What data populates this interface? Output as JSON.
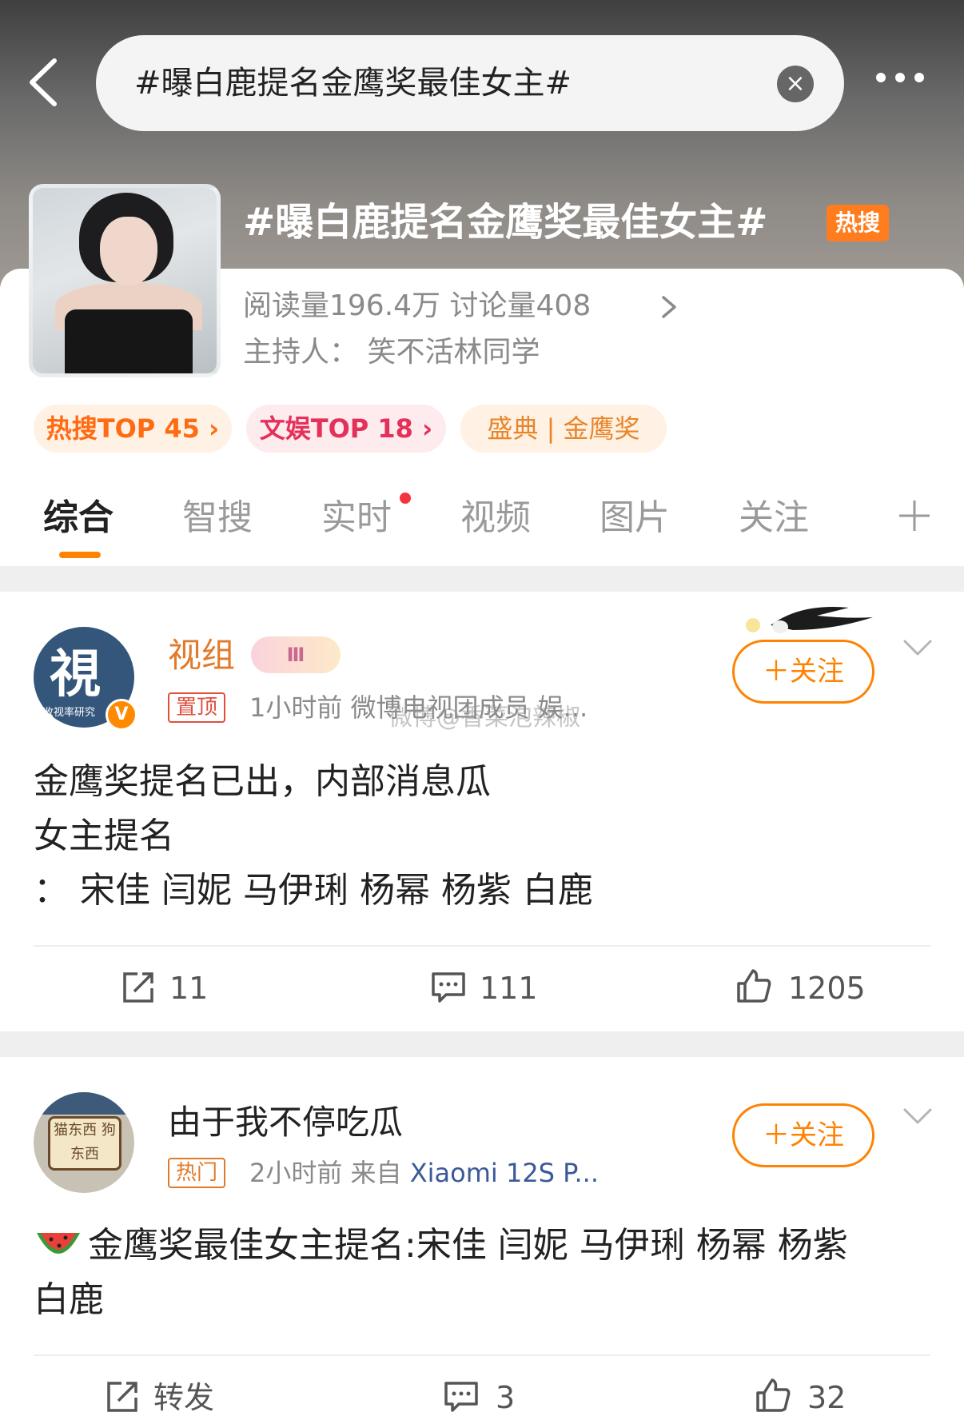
{
  "search": {
    "query": "#曝白鹿提名金鹰奖最佳女主#"
  },
  "topic": {
    "title": "#曝白鹿提名金鹰奖最佳女主#",
    "badge": "热搜",
    "stats": "阅读量196.4万  讨论量408",
    "host": "主持人：  笑不活林同学",
    "chips": [
      "热搜TOP 45 ›",
      "文娱TOP 18 ›",
      "盛典 | 金鹰奖"
    ]
  },
  "tabs": [
    "综合",
    "智搜",
    "实时",
    "视频",
    "图片",
    "关注"
  ],
  "posts": [
    {
      "author": "视组",
      "avatar_text": "視",
      "avatar_caption": "收视率研究",
      "level_badge": "Ⅲ",
      "verified_mark": "V",
      "tag": "置顶",
      "meta": "1小时前  微博电视团成员 娱...",
      "watermark": "微博@香菜泡辣椒",
      "follow_label": "＋关注",
      "lines": [
        "金鹰奖提名已出，内部消息瓜",
        "女主提名",
        "：  宋佳  闫妮  马伊琍  杨幂  杨紫  白鹿"
      ],
      "repost": "11",
      "comment": "111",
      "like": "1205"
    },
    {
      "author": "由于我不停吃瓜",
      "avatar_text": "猫东西 狗东西",
      "tag": "热门",
      "meta_time": "2小时前  来自 ",
      "meta_source": "Xiaomi 12S P...",
      "follow_label": "＋关注",
      "lines": [
        "金鹰奖最佳女主提名:宋佳  闫妮  马伊琍  杨幂  杨紫",
        "白鹿"
      ],
      "repost": "转发",
      "comment": "3",
      "like": "32"
    }
  ],
  "colors": {
    "accent": "#ff8200",
    "hot": "#ff7d1e",
    "link": "#3b5998"
  }
}
